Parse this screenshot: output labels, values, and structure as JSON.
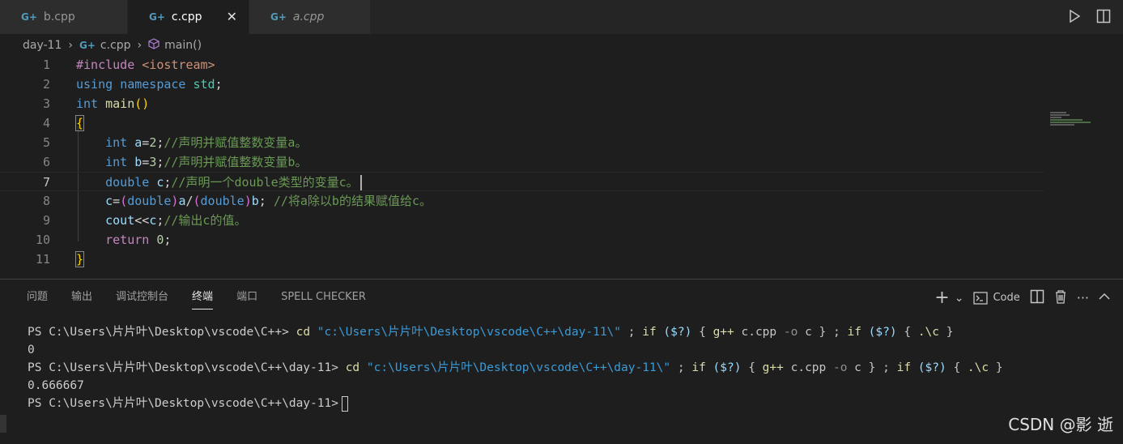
{
  "tabs": [
    {
      "icon": "cpp-icon",
      "glyph": "G+",
      "label": "b.cpp"
    },
    {
      "icon": "cpp-icon",
      "glyph": "G+",
      "label": "c.cpp",
      "close": "✕"
    },
    {
      "icon": "cpp-icon",
      "glyph": "G+",
      "label": "a.cpp"
    }
  ],
  "breadcrumb": {
    "folder": "day-11",
    "file": "c.cpp",
    "symbol": "main()",
    "sep": "›"
  },
  "code": {
    "line_numbers": [
      "1",
      "2",
      "3",
      "4",
      "5",
      "6",
      "7",
      "8",
      "9",
      "10",
      "11"
    ],
    "l1": {
      "pp": "#include",
      "inc": " <iostream>"
    },
    "l2": {
      "using": "using",
      "namespace": "namespace",
      "std": "std",
      "semi": ";"
    },
    "l3": {
      "int": "int",
      "main": "main",
      "lp": "(",
      "rp": ")"
    },
    "l4": {
      "brace": "{"
    },
    "l5": {
      "indent": "    ",
      "int": "int",
      "a": "a",
      "eq": "=",
      "n": "2",
      "semi": ";",
      "cmt": "//声明并赋值整数变量a。"
    },
    "l6": {
      "indent": "    ",
      "int": "int",
      "b": "b",
      "eq": "=",
      "n": "3",
      "semi": ";",
      "cmt": "//声明并赋值整数变量b。"
    },
    "l7": {
      "indent": "    ",
      "double": "double",
      "c": "c",
      "semi": ";",
      "cmt": "//声明一个double类型的变量c。"
    },
    "l8": {
      "indent": "    ",
      "c": "c",
      "eq": "=",
      "p1": "(",
      "d1": "double",
      "p2": ")",
      "a": "a",
      "slash": "/",
      "p3": "(",
      "d2": "double",
      "p4": ")",
      "b": "b",
      "semi": "; ",
      "cmt": "//将a除以b的结果赋值给c。"
    },
    "l9": {
      "indent": "    ",
      "cout": "cout",
      "op": "<<",
      "c": "c",
      "semi": ";",
      "cmt": "//输出c的值。"
    },
    "l10": {
      "indent": "    ",
      "ret": "return",
      "n": " 0",
      "semi": ";"
    },
    "l11": {
      "brace": "}"
    }
  },
  "panel": {
    "tabs": [
      "问题",
      "输出",
      "调试控制台",
      "终端",
      "端口",
      "SPELL CHECKER"
    ],
    "active_tab": "终端",
    "actions": {
      "add": "+",
      "dropdown": "⌄",
      "terminal_label": "Code",
      "more": "···",
      "collapse": "^"
    }
  },
  "terminal": {
    "l1": {
      "prompt": "PS C:\\Users\\片片叶\\Desktop\\vscode\\C++> ",
      "cd": "cd",
      "path": " \"c:\\Users\\片片叶\\Desktop\\vscode\\C++\\day-11\\\"",
      "semi1": " ; ",
      "if1": "if",
      "cond1": " ($?) ",
      "ob1": "{ ",
      "gpp": "g++",
      "file": " c.cpp ",
      "opt": "-o",
      "out": " c ",
      "cb1": "}",
      "semi2": " ; ",
      "if2": "if",
      "cond2": " ($?) ",
      "ob2": "{ ",
      "run": ".\\c",
      "cb2": " }"
    },
    "l2": "0",
    "l3": {
      "prompt": "PS C:\\Users\\片片叶\\Desktop\\vscode\\C++\\day-11> ",
      "cd": "cd",
      "path": " \"c:\\Users\\片片叶\\Desktop\\vscode\\C++\\day-11\\\"",
      "semi1": " ; ",
      "if1": "if",
      "cond1": " ($?) ",
      "ob1": "{ ",
      "gpp": "g++",
      "file": " c.cpp ",
      "opt": "-o",
      "out": " c ",
      "cb1": "}",
      "semi2": " ; ",
      "if2": "if",
      "cond2": " ($?) ",
      "ob2": "{ ",
      "run": ".\\c",
      "cb2": " }"
    },
    "l4": "0.666667",
    "l5": {
      "prompt": "PS C:\\Users\\片片叶\\Desktop\\vscode\\C++\\day-11>"
    }
  },
  "watermark": "CSDN @影 逝",
  "colors": {
    "editor_bg": "#1e1e1e",
    "tab_bar_bg": "#252526",
    "keyword": "#569cd6",
    "control": "#c586c0",
    "comment": "#6a9955",
    "string": "#ce9178",
    "number": "#b5cea8",
    "function": "#dcdcaa",
    "type": "#4ec9b0"
  }
}
